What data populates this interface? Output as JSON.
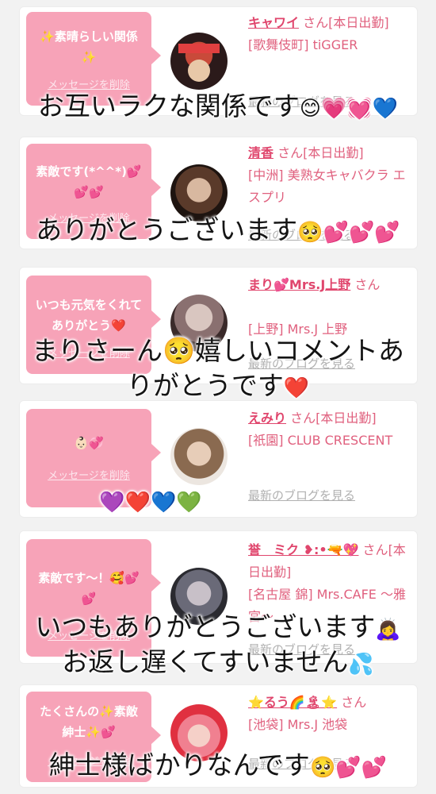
{
  "cards": [
    {
      "bubble_message": "✨素晴らしい関係✨",
      "delete_label": "メッセージを削除",
      "name": "キャワイ",
      "honorific": "さん",
      "status": "[本日出勤]",
      "shop": "[歌舞伎町] tiGGER",
      "blog_label": "最新のブログを見る",
      "avatar_colors": [
        "#2b1a1a",
        "#c94a3a",
        "#e8c8a8"
      ]
    },
    {
      "bubble_message": "素敵です(*^^*)💕💕💕",
      "delete_label": "メッセージを削除",
      "name": "清香",
      "honorific": "さん",
      "status": "[本日出勤]",
      "shop": "[中洲] 美熟女キャバクラ エスプリ",
      "blog_label": "最新のブログを見る",
      "avatar_colors": [
        "#1e1410",
        "#5a3a2a",
        "#d8b8a0"
      ]
    },
    {
      "bubble_message": "いつも元気をくれてありがとう❤️",
      "delete_label": "メッセージを削除",
      "name": "まり💕Mrs.J上野",
      "honorific": "さん",
      "status": "",
      "shop": "[上野] Mrs.J 上野",
      "blog_label": "最新のブログを見る",
      "avatar_colors": [
        "#3a2a2a",
        "#8a7070",
        "#d9c6c0"
      ]
    },
    {
      "bubble_message": "👶🏻💞",
      "delete_label": "メッセージを削除",
      "name": "えみり",
      "honorific": "さん",
      "status": "[本日出勤]",
      "shop": "[祇園] CLUB CRESCENT",
      "blog_label": "最新のブログを見る",
      "avatar_colors": [
        "#ece6e0",
        "#8a6a50",
        "#e7cdb8"
      ]
    },
    {
      "bubble_message": "素敵です〜！🥰💕💕",
      "delete_label": "メッセージを削除",
      "name": "誉　ミク ❥:•🔫💖",
      "honorific": "さん",
      "status": "[本日出勤]",
      "shop": "[名古屋 錦] Mrs.CAFE 〜雅宮〜",
      "blog_label": "最新のブログを見る",
      "avatar_colors": [
        "#2a2a30",
        "#6a6a78",
        "#c8c0c8"
      ]
    },
    {
      "bubble_message": "たくさんの✨素敵紳士✨💕",
      "delete_label": "メッセージを削除",
      "name": "⭐️るう🌈🏝⭐️",
      "honorific": "さん",
      "status": "",
      "shop": "[池袋] Mrs.J 池袋",
      "blog_label": "最新のブログを見る",
      "avatar_colors": [
        "#e03040",
        "#f08090",
        "#f5d0c8"
      ]
    }
  ],
  "overlay_captions": [
    {
      "text": "お互いラクな関係です",
      "emoji": "😊💗💓💙"
    },
    {
      "text": "ありがとうございます",
      "emoji": "🥺💕💕💕"
    },
    {
      "text": "まりさーん🥺嬉しいコメントあ",
      "emoji": ""
    },
    {
      "text": "りがとうです",
      "emoji": "❤️"
    },
    {
      "text": "",
      "emoji": "💜❤️💙💚"
    },
    {
      "text": "いつもありがとうございます",
      "emoji": "🙇‍♀️"
    },
    {
      "text": "お返し遅くてすいません",
      "emoji": "💦"
    },
    {
      "text": "紳士様ばかりなんです",
      "emoji": "🥺💕💕"
    }
  ]
}
